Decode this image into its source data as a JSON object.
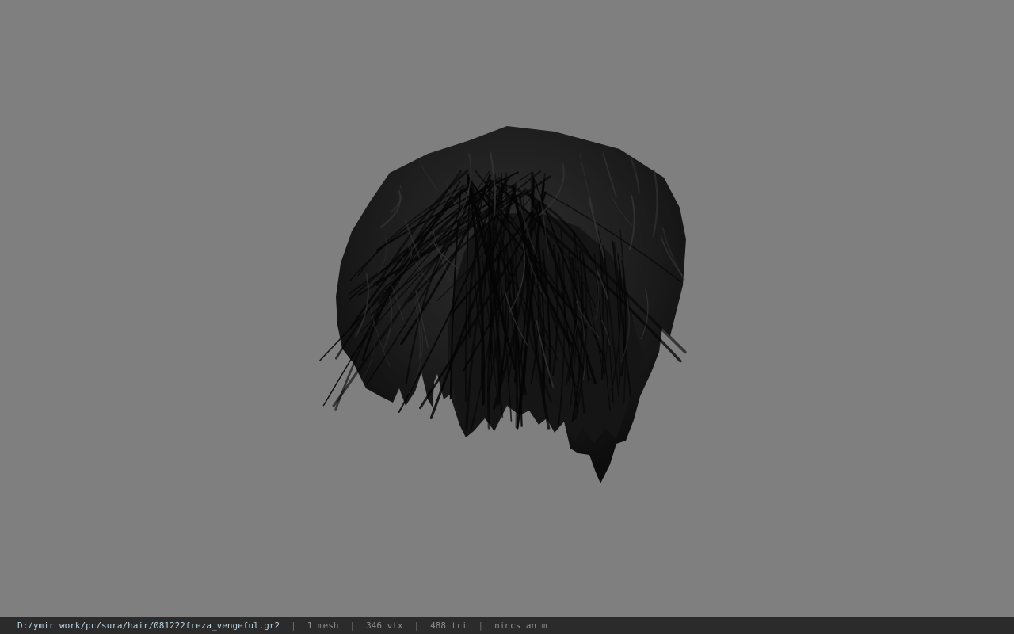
{
  "viewport": {
    "background_color": "#7f7f7f",
    "model": {
      "icon": "hair-mesh",
      "color": "#1a1a1a",
      "strand_color": "#050505",
      "highlight_color": "#3a3a3a"
    }
  },
  "status_bar": {
    "file_path": "D:/ymir work/pc/sura/hair/081222freza_vengeful.gr2",
    "separator": "|",
    "mesh_count": "1 mesh",
    "vertex_count": "346 vtx",
    "triangle_count": "488 tri",
    "anim_info": "nincs anim",
    "background_color": "#2b2b2b",
    "path_color": "#b9d3e0"
  }
}
